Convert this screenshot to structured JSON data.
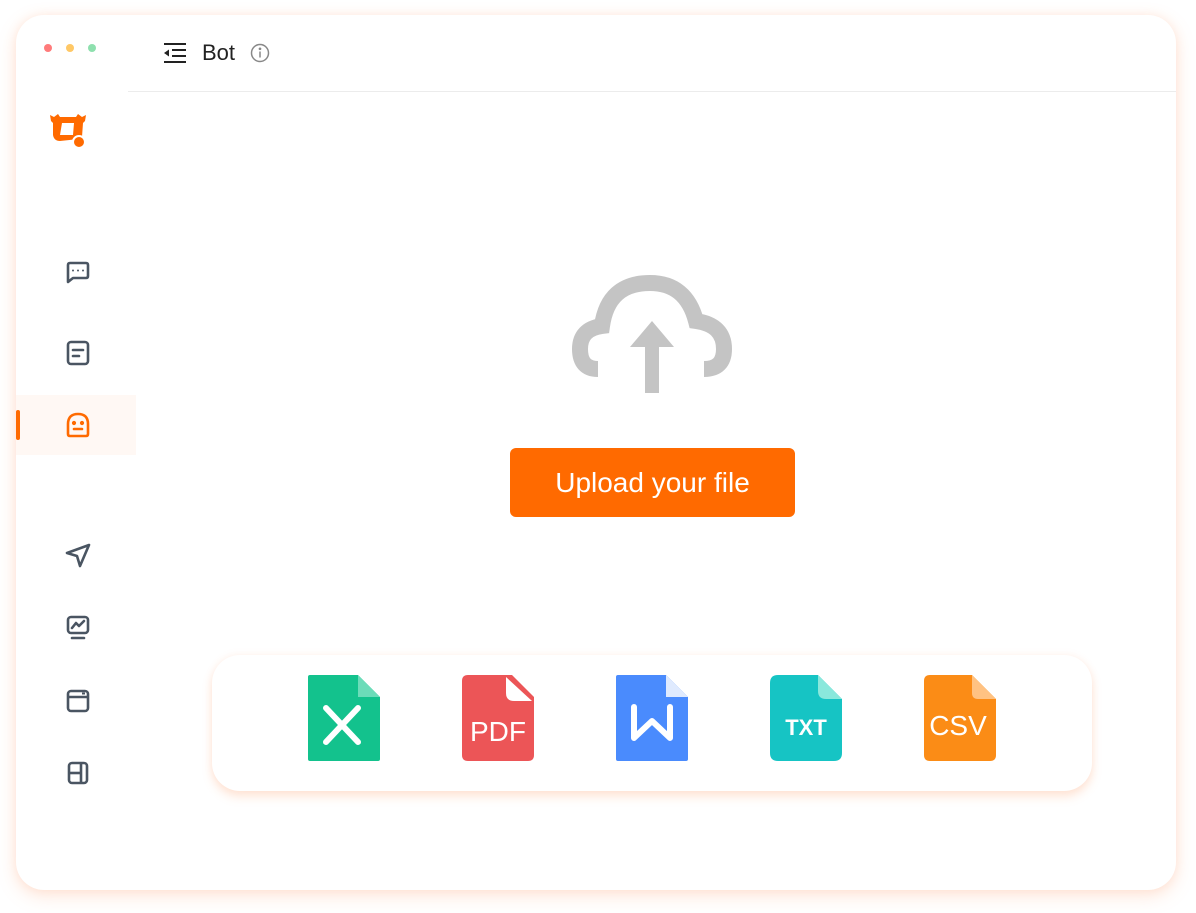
{
  "window": {
    "traffic_lights": [
      {
        "name": "close",
        "color": "#ff7b7b"
      },
      {
        "name": "minimize",
        "color": "#ffc866"
      },
      {
        "name": "maximize",
        "color": "#8ee0ae"
      }
    ]
  },
  "header": {
    "title": "Bot",
    "menu_icon": "menu-collapse-icon",
    "info_icon": "info-icon"
  },
  "sidebar": {
    "logo": "bull-logo-icon",
    "items": [
      {
        "id": "chat",
        "icon": "chat-bubble-icon",
        "active": false
      },
      {
        "id": "documents",
        "icon": "document-icon",
        "active": false
      },
      {
        "id": "bot",
        "icon": "bot-icon",
        "active": true
      },
      {
        "id": "send",
        "icon": "send-icon",
        "active": false
      },
      {
        "id": "monitor",
        "icon": "monitor-chart-icon",
        "active": false
      },
      {
        "id": "window",
        "icon": "window-icon",
        "active": false
      },
      {
        "id": "layout",
        "icon": "panel-layout-icon",
        "active": false
      }
    ]
  },
  "main": {
    "upload_icon": "cloud-upload-icon",
    "upload_button_label": "Upload your file",
    "supported_formats": [
      {
        "type": "xlsx",
        "label": "",
        "color": "#13c28d"
      },
      {
        "type": "pdf",
        "label": "PDF",
        "color": "#ec5557"
      },
      {
        "type": "docx",
        "label": "",
        "color": "#4a8bfd"
      },
      {
        "type": "txt",
        "label": "TXT",
        "color": "#16c4c4"
      },
      {
        "type": "csv",
        "label": "CSV",
        "color": "#fb8c16"
      }
    ]
  },
  "colors": {
    "accent": "#ff6a00",
    "icon_default": "#4a5562",
    "cloud": "#c4c4c4"
  }
}
